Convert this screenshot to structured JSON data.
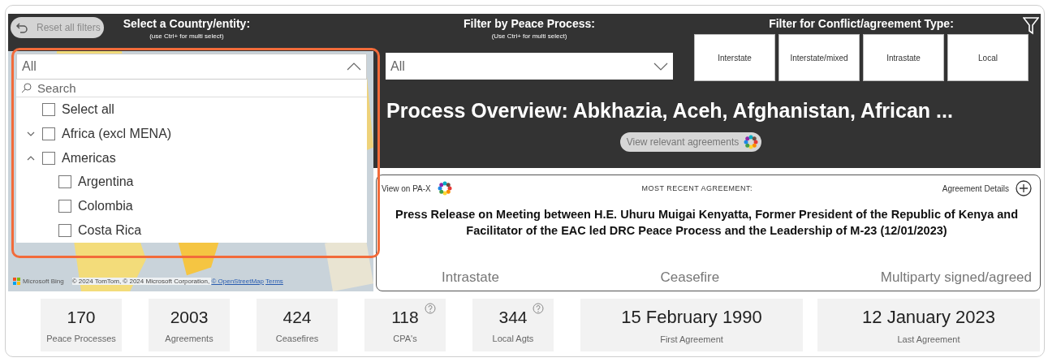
{
  "reset_button": {
    "label": "Reset all filters"
  },
  "country_filter": {
    "title": "Select a Country/entity:",
    "hint": "(use Ctrl+ for multi select)",
    "value": "All",
    "expanded": true,
    "search": {
      "placeholder": "Search"
    },
    "items": [
      {
        "label": "Select all",
        "checked": false
      },
      {
        "label": "Africa (excl MENA)",
        "checked": false,
        "expanded": false
      },
      {
        "label": "Americas",
        "checked": false,
        "expanded": true,
        "children": [
          {
            "label": "Argentina",
            "checked": false
          },
          {
            "label": "Colombia",
            "checked": false
          },
          {
            "label": "Costa Rica",
            "checked": false
          }
        ]
      }
    ]
  },
  "peace_process_filter": {
    "title": "Filter by Peace Process:",
    "hint": "(Use Ctrl+ for multi select)",
    "value": "All",
    "expanded": false
  },
  "type_filter": {
    "title": "Filter for Conflict/agreement Type:",
    "options": [
      {
        "label": "Interstate",
        "selected": false
      },
      {
        "label": "Interstate/mixed",
        "selected": false
      },
      {
        "label": "Intrastate",
        "selected": false
      },
      {
        "label": "Local",
        "selected": false
      }
    ]
  },
  "map": {
    "provider": "Microsoft Bing",
    "attribution": "© 2024 TomTom, © 2024 Microsoft Corporation, ",
    "attribution_link": "© OpenStreetMap",
    "terms_link": "Terms"
  },
  "overview": {
    "title": "Process Overview: Abkhazia, Aceh, Afghanistan, African ...",
    "agreements_button": "View relevant agreements"
  },
  "recent_agreement": {
    "view_link": "View on PA-X",
    "heading": "MOST RECENT AGREEMENT:",
    "details_link": "Agreement Details",
    "title": "Press Release on Meeting between H.E. Uhuru Muigai Kenyatta, Former President of the Republic of Kenya and Facilitator of the EAC led DRC Peace Process and the Leadership of M-23 (12/01/2023)",
    "tags": [
      "Intrastate",
      "Ceasefire",
      "Multiparty signed/agreed"
    ]
  },
  "stats": [
    {
      "value": "170",
      "label": "Peace Processes",
      "kind": "count",
      "help": false
    },
    {
      "value": "2003",
      "label": "Agreements",
      "kind": "count",
      "help": false
    },
    {
      "value": "424",
      "label": "Ceasefires",
      "kind": "count",
      "help": false
    },
    {
      "value": "118",
      "label": "CPA's",
      "kind": "count",
      "help": true
    },
    {
      "value": "344",
      "label": "Local Agts",
      "kind": "count",
      "help": true
    },
    {
      "value": "15 February 1990",
      "label": "First Agreement",
      "kind": "date",
      "help": false
    },
    {
      "value": "12 January 2023",
      "label": "Last Agreement",
      "kind": "date",
      "help": false
    }
  ]
}
